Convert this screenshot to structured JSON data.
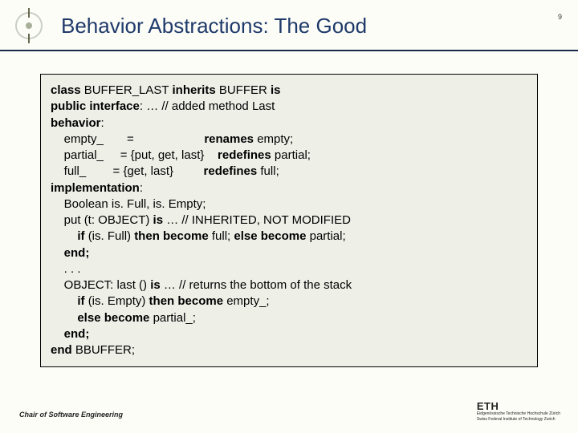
{
  "header": {
    "title": "Behavior Abstractions: The Good",
    "page_number": "9"
  },
  "code": {
    "l1a": "class ",
    "l1b": "BUFFER_LAST ",
    "l1c": "inherits ",
    "l1d": "BUFFER ",
    "l1e": "is",
    "l2a": "public interface",
    "l2b": ": … // added method Last",
    "l3a": "behavior",
    "l3b": ":",
    "l4a": "    empty_       =                     ",
    "l4b": "renames ",
    "l4c": "empty;",
    "l5a": "    partial_     = {put, get, last}    ",
    "l5b": "redefines ",
    "l5c": "partial;",
    "l6a": "    full_        = {get, last}         ",
    "l6b": "redefines ",
    "l6c": "full;",
    "l7a": "implementation",
    "l7b": ":",
    "l8": "    Boolean is. Full, is. Empty;",
    "l9a": "    put (t: OBJECT) ",
    "l9b": "is",
    "l9c": " … // INHERITED, NOT MODIFIED",
    "l10a": "        ",
    "l10b": "if ",
    "l10c": "(is. Full) ",
    "l10d": "then become ",
    "l10e": "full; ",
    "l10f": "else become ",
    "l10g": "partial;",
    "l11a": "    ",
    "l11b": "end;",
    "l12": "    . . .",
    "l13a": "    OBJECT: last () ",
    "l13b": "is",
    "l13c": " … // returns the bottom of the stack",
    "l14a": "        ",
    "l14b": "if ",
    "l14c": "(is. Empty) ",
    "l14d": "then become ",
    "l14e": "empty_;",
    "l15a": "        ",
    "l15b": "else become ",
    "l15c": "partial_;",
    "l16a": "    ",
    "l16b": "end;",
    "l17a": "end ",
    "l17b": "BBUFFER;"
  },
  "footer": {
    "chair": "Chair of Software Engineering",
    "eth": "ETH",
    "eth_sub1": "Eidgenössische Technische Hochschule Zürich",
    "eth_sub2": "Swiss Federal Institute of Technology Zurich"
  }
}
